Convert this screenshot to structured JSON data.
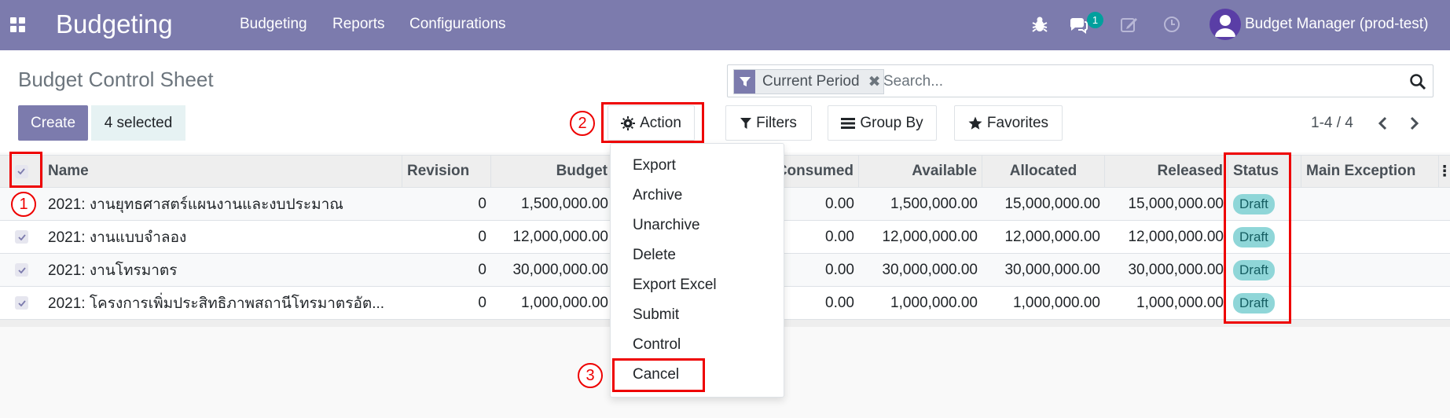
{
  "navbar": {
    "brand": "Budgeting",
    "menu": [
      "Budgeting",
      "Reports",
      "Configurations"
    ],
    "message_badge": "1",
    "user": "Budget Manager (prod-test)",
    "icons": [
      "apps-icon",
      "bug-icon",
      "chat-icon",
      "edit-icon",
      "clock-icon",
      "avatar"
    ]
  },
  "control_panel": {
    "title": "Budget Control Sheet",
    "create_label": "Create",
    "selected_label": "4 selected",
    "action_label": "Action",
    "filters_label": "Filters",
    "groupby_label": "Group By",
    "favorites_label": "Favorites",
    "pager": "1-4 / 4",
    "search": {
      "facet": "Current Period",
      "placeholder": "Search..."
    }
  },
  "table": {
    "columns": [
      "Name",
      "Revision",
      "Budget",
      "Consumed",
      "Available",
      "Allocated",
      "Released",
      "Status",
      "Main Exception"
    ],
    "rows": [
      {
        "name": "2021: งานยุทธศาสตร์แผนงานและงบประมาณ",
        "revision": "0",
        "budget": "1,500,000.00",
        "consumed": "0.00",
        "available": "1,500,000.00",
        "allocated": "15,000,000.00",
        "released": "15,000,000.00",
        "status": "Draft"
      },
      {
        "name": "2021: งานแบบจำลอง",
        "revision": "0",
        "budget": "12,000,000.00",
        "consumed": "0.00",
        "available": "12,000,000.00",
        "allocated": "12,000,000.00",
        "released": "12,000,000.00",
        "status": "Draft"
      },
      {
        "name": "2021: งานโทรมาตร",
        "revision": "0",
        "budget": "30,000,000.00",
        "consumed": "0.00",
        "available": "30,000,000.00",
        "allocated": "30,000,000.00",
        "released": "30,000,000.00",
        "status": "Draft"
      },
      {
        "name": "2021: โครงการเพิ่มประสิทธิภาพสถานีโทรมาตรอัต...",
        "revision": "0",
        "budget": "1,000,000.00",
        "consumed": "0.00",
        "available": "1,000,000.00",
        "allocated": "1,000,000.00",
        "released": "1,000,000.00",
        "status": "Draft"
      }
    ]
  },
  "action_menu": {
    "items": [
      "Export",
      "Archive",
      "Unarchive",
      "Delete",
      "Export Excel",
      "Submit",
      "Control",
      "Cancel"
    ]
  },
  "annotations": {
    "step1": "1",
    "step2": "2",
    "step3": "3"
  },
  "colors": {
    "navbar": "#7c7bad",
    "primary": "#7c7bad",
    "status_badge": "#8fd6d8",
    "annotation": "#e00000"
  }
}
